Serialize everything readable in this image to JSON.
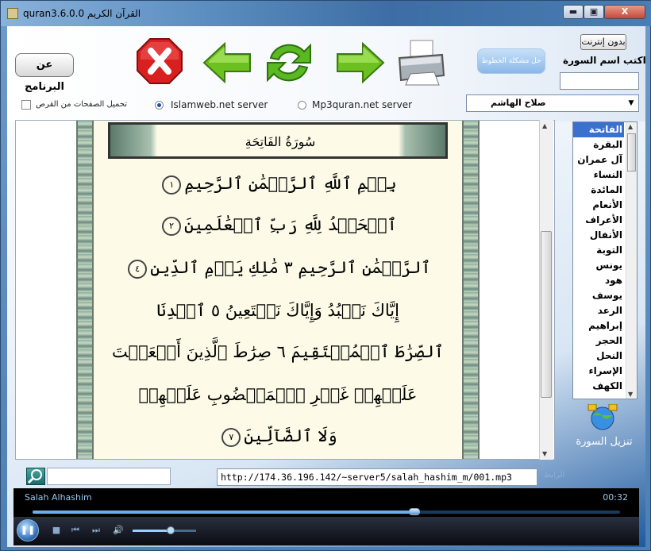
{
  "window": {
    "title": "quran3.6.0.0 القرآن الكريم",
    "min_glyph": "▬",
    "max_glyph": "▣",
    "close_glyph": "X"
  },
  "toolbar": {
    "about_label": "عن البرنامج",
    "fonts_fix_label": "حل مشكلة الخطوط",
    "offline_label": "بدون إنترنت",
    "sura_name_label": "اكتب اسم السورة",
    "sura_name_value": "",
    "icons": [
      "exit-icon",
      "back-arrow-icon",
      "refresh-icon",
      "forward-arrow-icon",
      "printer-icon"
    ]
  },
  "reciter": {
    "selected": "صلاح الهاشم",
    "arrow": "▼"
  },
  "server": {
    "mp3_label": "Mp3quran.net server",
    "islamweb_label": "Islamweb.net server",
    "selected": "islamweb",
    "offline_pages_label": "تحميل الصفحات من القرص"
  },
  "page": {
    "sura_title": "سُورَةُ الفَاتِحَةِ",
    "verses": [
      {
        "text": "بِسۡمِ ٱللَّهِ ٱلرَّحۡمَٰنِ ٱلرَّحِيمِ",
        "num": "١"
      },
      {
        "text": "ٱلۡحَمۡدُ لِلَّهِ رَبِّ ٱلۡعَٰلَمِينَ",
        "num": "٢"
      },
      {
        "text": "ٱلرَّحۡمَٰنِ ٱلرَّحِيمِ ٣ مَٰلِكِ يَوۡمِ ٱلدِّينِ",
        "num": "٤"
      },
      {
        "text": "إِيَّاكَ نَعۡبُدُ وَإِيَّاكَ نَسۡتَعِينُ ٥ ٱهۡدِنَا",
        "num": ""
      },
      {
        "text": "ٱلصِّرَٰطَ ٱلۡمُسۡتَقِيمَ ٦ صِرَٰطَ ٱلَّذِينَ أَنۡعَمۡتَ",
        "num": ""
      },
      {
        "text": "عَلَيۡهِمۡ غَيۡرِ ٱلۡمَغۡضُوبِ عَلَيۡهِمۡ",
        "num": ""
      },
      {
        "text": "وَلَا ٱلضَّآلِّينَ",
        "num": "٧"
      }
    ]
  },
  "suras": [
    {
      "name": "الفاتحة",
      "selected": true
    },
    {
      "name": "البقرة"
    },
    {
      "name": "آل عمران"
    },
    {
      "name": "النساء"
    },
    {
      "name": "المائدة"
    },
    {
      "name": "الأنعام"
    },
    {
      "name": "الأعراف"
    },
    {
      "name": "الأنفال"
    },
    {
      "name": "التوبة"
    },
    {
      "name": "يونس"
    },
    {
      "name": "هود"
    },
    {
      "name": "يوسف"
    },
    {
      "name": "الرعد"
    },
    {
      "name": "إبراهيم"
    },
    {
      "name": "الحجر"
    },
    {
      "name": "النحل"
    },
    {
      "name": "الإسراء"
    },
    {
      "name": "الكهف"
    }
  ],
  "download": {
    "label": "تنزيل السورة"
  },
  "search": {
    "value": ""
  },
  "url": {
    "value": "http://174.36.196.142/~server5/salah_hashim_m/001.mp3"
  },
  "reciter_faint": "الرابط",
  "player": {
    "title": "Salah Alhashim",
    "time": "00:32",
    "progress": 0.65,
    "volume": 0.6,
    "play_glyph": "❚❚",
    "stop_glyph": "■",
    "prev_glyph": "⏮",
    "next_glyph": "⏭",
    "vol_glyph": "🔊"
  },
  "colors": {
    "selection": "#3a70d0",
    "player_text": "#9ac8f0"
  }
}
